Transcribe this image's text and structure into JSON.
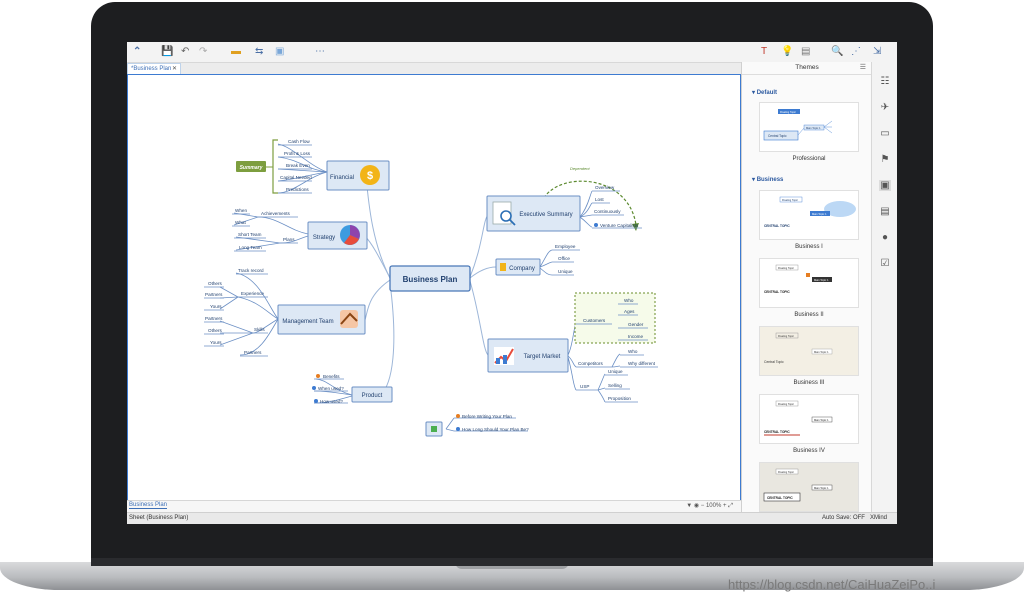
{
  "document_tab": {
    "label": "*Business Plan",
    "close": "✕"
  },
  "toolbar": {
    "logo": "⌃",
    "save": "💾",
    "undo": "↶",
    "redo": "↷",
    "insert": "▬",
    "relationship": "⇆",
    "boundary": "▣",
    "more": "⋯",
    "format": "T",
    "idea": "💡",
    "presentation": "▤",
    "search": "🔍",
    "share": "⋰",
    "export": "⇲"
  },
  "map": {
    "central": "Business Plan",
    "financial": {
      "label": "Financial",
      "summary": "Summary",
      "items": [
        "Cash Flow",
        "Profit & Loss",
        "Break Even",
        "Capital Needed",
        "Predictions"
      ]
    },
    "strategy": {
      "label": "Strategy",
      "achievements": "Achievements",
      "plans": "Plans",
      "items": [
        "When",
        "What",
        "Short Team",
        "Long Team"
      ]
    },
    "management": {
      "label": "Management Team",
      "track": "Track record",
      "experience": "Experience",
      "skills": "Skills",
      "partners": "Partners",
      "items": [
        "Others",
        "Partners",
        "Yours",
        "Partners",
        "Others",
        "Yours"
      ]
    },
    "product": {
      "label": "Product",
      "items": [
        "Benefits",
        "When used?",
        "How used?"
      ]
    },
    "executive": {
      "label": "Executive Summary",
      "dependent": "Dependent",
      "items": [
        "Overview",
        "Lost",
        "Continuously",
        "Venture Capitalists"
      ]
    },
    "company": {
      "label": "Company",
      "items": [
        "Employee",
        "Office",
        "Unique"
      ]
    },
    "target": {
      "label": "Target Market",
      "customers": "Customers",
      "competitors": "Competitors",
      "usp": "USP",
      "customer_items": [
        "Who",
        "Ages",
        "Gender",
        "Income"
      ],
      "competitor_items": [
        "Who",
        "Why different"
      ],
      "usp_items": [
        "Unique",
        "Selling",
        "Proposition"
      ]
    },
    "floating": {
      "items": [
        "Before Writing Your Plan",
        "How Long Should Your Plan Be?"
      ]
    }
  },
  "themes": {
    "title": "Themes",
    "groups": [
      {
        "label": "Default"
      },
      {
        "label": "Business"
      }
    ],
    "cards": [
      {
        "name": "Professional",
        "central": "Central Topic",
        "floating": "Floating Topic",
        "main": "Main Topic 1"
      },
      {
        "name": "Business I",
        "central": "CENTRAL TOPIC",
        "floating": "Floating Topic",
        "main": "Main Topic 1"
      },
      {
        "name": "Business II",
        "central": "CENTRAL TOPIC",
        "floating": "Floating Topic",
        "main": "Main Topic 1"
      },
      {
        "name": "Business III",
        "central": "Central Topic",
        "floating": "Floating Topic",
        "main": "Main Topic 1"
      },
      {
        "name": "Business IV",
        "central": "CENTRAL TOPIC",
        "floating": "Floating Topic",
        "main": "Main Topic 1"
      },
      {
        "name": "",
        "central": "CENTRAL TOPIC",
        "floating": "Floating Topic",
        "main": "Main Topic 1"
      }
    ]
  },
  "sheet": {
    "tab": "Business Plan",
    "zoom": "100%"
  },
  "status": {
    "sheet": "Sheet (Business Plan)",
    "autosave": "Auto Save: OFF",
    "app": "XMind"
  },
  "watermark": "https://blog.csdn.net/CaiHuaZeiPo..i",
  "colors": {
    "accent": "#3d7bd1",
    "topic_fill": "#dde8f5",
    "topic_border": "#6b8fc4",
    "summary": "#7d9e3f",
    "dependent": "#5c8a2f",
    "dollar": "#f2b418"
  }
}
